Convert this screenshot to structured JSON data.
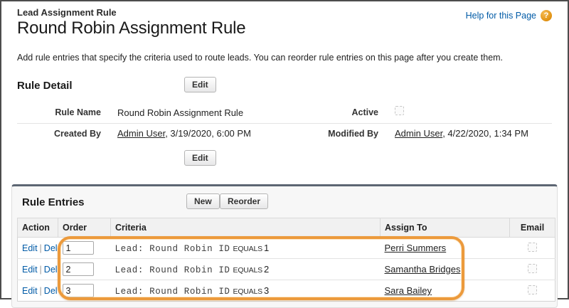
{
  "page": {
    "breadcrumb": "Lead Assignment Rule",
    "title": "Round Robin Assignment Rule",
    "help_link": "Help for this Page",
    "help_icon": "?",
    "description": "Add rule entries that specify the criteria used to route leads. You can reorder rule entries on this page after you create them."
  },
  "colors": {
    "link_blue": "#015ba7",
    "highlight_orange": "#ec9a3c",
    "help_icon_orange": "#e09112",
    "section_top_border": "#5d6673"
  },
  "rule_detail": {
    "heading": "Rule Detail",
    "edit_button": "Edit",
    "fields": {
      "rule_name": {
        "label": "Rule Name",
        "value": "Round Robin Assignment Rule"
      },
      "active": {
        "label": "Active",
        "checked": false
      },
      "created_by": {
        "label": "Created By",
        "link": "Admin User",
        "rest": ", 3/19/2020, 6:00 PM"
      },
      "modified_by": {
        "label": "Modified By",
        "link": "Admin User",
        "rest": ", 4/22/2020, 1:34 PM"
      }
    }
  },
  "rule_entries": {
    "heading": "Rule Entries",
    "new_button": "New",
    "reorder_button": "Reorder",
    "table": {
      "headers": [
        "Action",
        "Order",
        "Criteria",
        "Assign To",
        "Email"
      ],
      "action_edit": "Edit",
      "action_sep": "|",
      "action_del": "Del",
      "rows": [
        {
          "order": "1",
          "criteria_field": "Lead: Round Robin ID",
          "criteria_op": "EQUALS",
          "criteria_value": "1",
          "assign_to": "Perri Summers",
          "email_checked": false
        },
        {
          "order": "2",
          "criteria_field": "Lead: Round Robin ID",
          "criteria_op": "EQUALS",
          "criteria_value": "2",
          "assign_to": "Samantha Bridges",
          "email_checked": false
        },
        {
          "order": "3",
          "criteria_field": "Lead: Round Robin ID",
          "criteria_op": "EQUALS",
          "criteria_value": "3",
          "assign_to": "Sara Bailey",
          "email_checked": false
        }
      ]
    }
  }
}
